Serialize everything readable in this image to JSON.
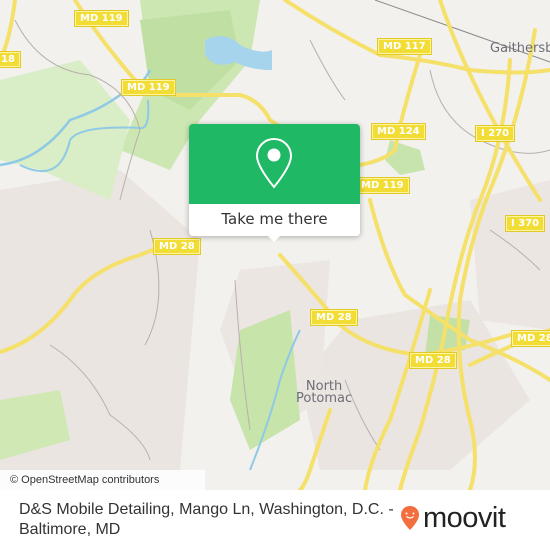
{
  "map": {
    "road_shields": [
      {
        "id": "md119-top",
        "label": "MD 119"
      },
      {
        "id": "md119-mid",
        "label": "MD 119"
      },
      {
        "id": "md118-edge",
        "label": "18"
      },
      {
        "id": "md117",
        "label": "MD 117"
      },
      {
        "id": "md124",
        "label": "MD 124"
      },
      {
        "id": "i270",
        "label": "I 270"
      },
      {
        "id": "md119-right",
        "label": "MD 119"
      },
      {
        "id": "i370",
        "label": "I 370"
      },
      {
        "id": "md28-left",
        "label": "MD 28"
      },
      {
        "id": "md28-center",
        "label": "MD 28"
      },
      {
        "id": "md28-lower",
        "label": "MD 28"
      },
      {
        "id": "md28-right",
        "label": "MD 28"
      }
    ],
    "places": {
      "gaithersburg": "Gaithersb",
      "north_potomac": "North\nPotomac"
    },
    "attribution": "© OpenStreetMap contributors",
    "colors": {
      "background": "#f2f1ee",
      "park": "#cfe8b4",
      "forest": "#b8dc9a",
      "water": "#a6d4ec",
      "road_major": "#f5e06a",
      "residential": "#ebe4e0"
    }
  },
  "popup": {
    "icon": "map-pin-icon",
    "action_label": "Take me there",
    "color": "#1fb864"
  },
  "footer": {
    "title": "D&S Mobile Detailing, Mango Ln, Washington, D.C. - Baltimore, MD",
    "logo_text": "moovit",
    "logo_color": "#f36f3f"
  }
}
